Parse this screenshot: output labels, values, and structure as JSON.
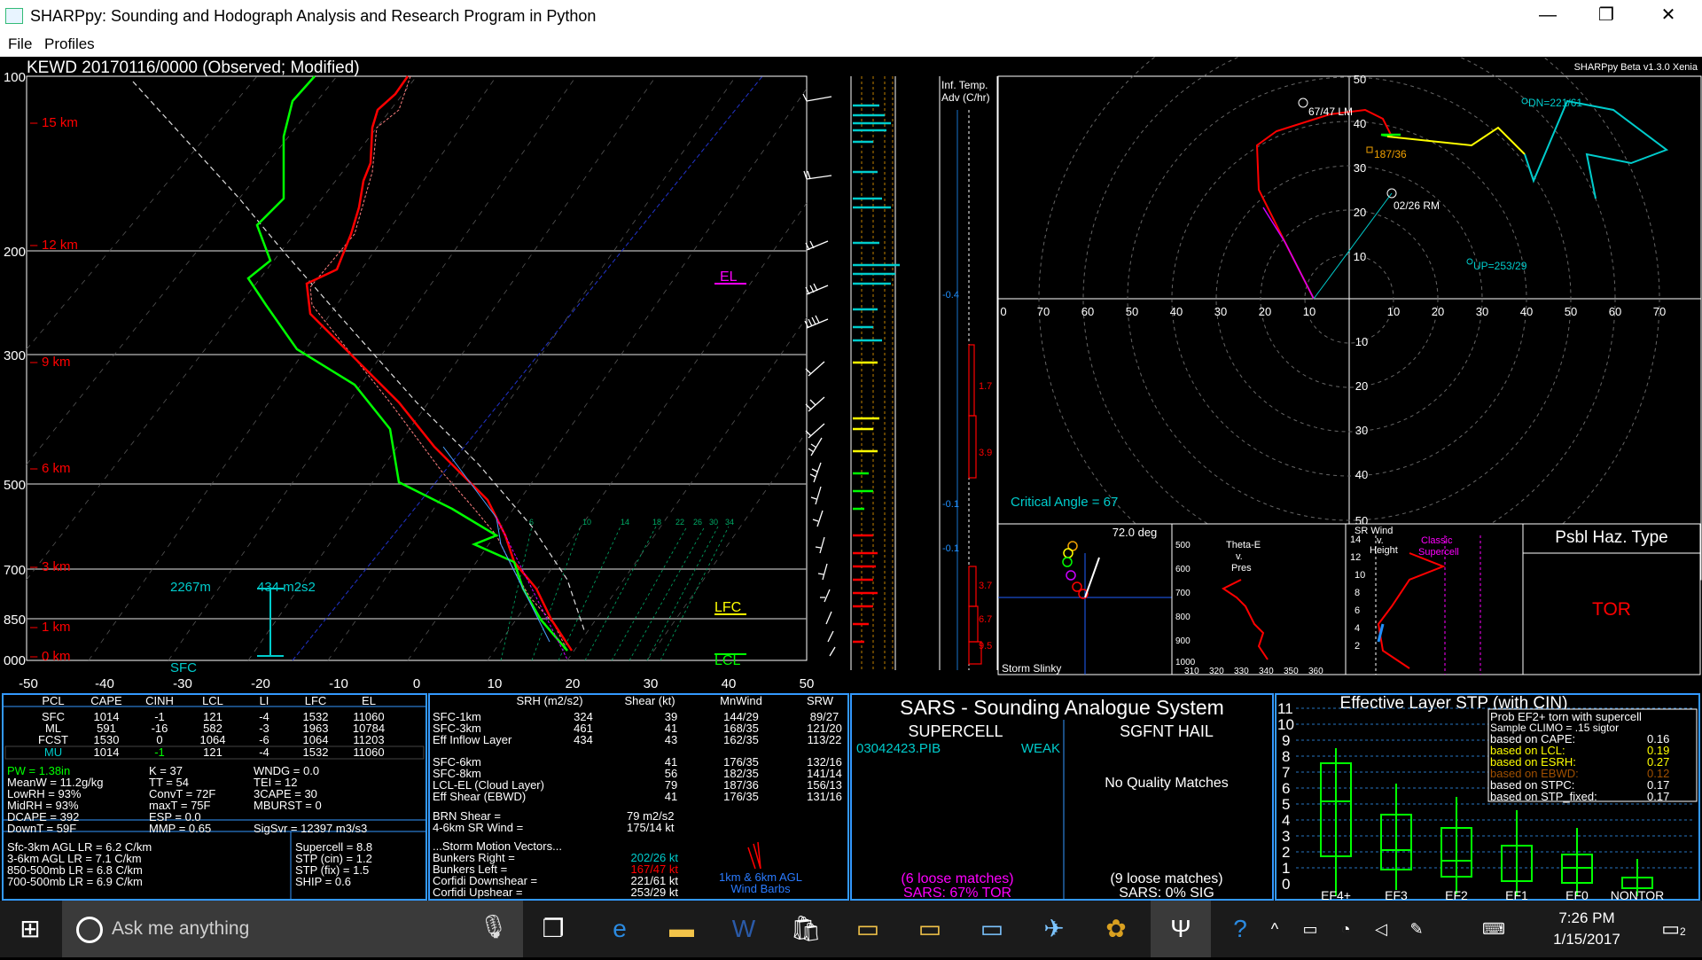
{
  "window": {
    "title": "SHARPpy: Sounding and Hodograph Analysis and Research Program in Python",
    "minimize": "—",
    "maximize": "❐",
    "close": "✕"
  },
  "menu": {
    "file": "File",
    "profiles": "Profiles"
  },
  "version": "SHARPpy Beta v1.3.0 Xenia",
  "skewt": {
    "header": "KEWD   20170116/0000  (Observed; Modified)",
    "pressure_labels": [
      "100",
      "200",
      "300",
      "500",
      "700",
      "850",
      "000"
    ],
    "height_labels": [
      "15 km",
      "12 km",
      "9 km",
      "6 km",
      "3 km",
      "1 km",
      "0 km"
    ],
    "temp_ticks": [
      "-50",
      "-40",
      "-30",
      "-20",
      "-10",
      "0",
      "10",
      "20",
      "30",
      "40",
      "50"
    ],
    "el": "EL",
    "lfc": "LFC",
    "lcl": "LCL",
    "eff_inflow_depth": "2267m",
    "eff_inflow_srh": "434 m2s2",
    "sfc": "SFC",
    "mix_ticks": [
      "6",
      "10",
      "14",
      "18",
      "22",
      "26",
      "30",
      "34"
    ]
  },
  "inf_temp": {
    "title": "Inf. Temp.",
    "subtitle": "Adv (C/hr)",
    "values": [
      "-0.4",
      "1.7",
      "3.9",
      "-0.1",
      "-0.1",
      "3.7",
      "6.7",
      "9.5"
    ]
  },
  "hodo": {
    "labels_top": [
      "50",
      "40",
      "30",
      "20",
      "10"
    ],
    "labels_bottom": [
      "10",
      "20",
      "30",
      "40",
      "50"
    ],
    "labels_x": [
      "0",
      "70",
      "60",
      "50",
      "40",
      "30",
      "20",
      "10",
      "10",
      "20",
      "30",
      "40",
      "50",
      "60",
      "70"
    ],
    "lm": "67/47 LM",
    "rm": "02/26 RM",
    "mean": "187/36",
    "corfidi_dn": "DN=221/61",
    "corfidi_up": "UP=253/29",
    "critical_angle": "Critical Angle = 67"
  },
  "slinky": {
    "angle": "72.0 deg",
    "title": "Storm Slinky"
  },
  "theta": {
    "title1": "Theta-E",
    "title2": "v.",
    "title3": "Pres",
    "yticks": [
      "500",
      "600",
      "700",
      "800",
      "900",
      "1000"
    ],
    "xticks": [
      "310",
      "320",
      "330",
      "340",
      "350",
      "360"
    ]
  },
  "srwind": {
    "title1": "SR Wind",
    "title2": "v.",
    "title3": "Height",
    "classic": "Classic",
    "supercell": "Supercell",
    "yticks": [
      "14",
      "12",
      "10",
      "8",
      "6",
      "4",
      "2"
    ]
  },
  "haz": {
    "title": "Psbl Haz. Type",
    "value": "TOR"
  },
  "parcels": {
    "headers": [
      "PCL",
      "CAPE",
      "CINH",
      "LCL",
      "LI",
      "LFC",
      "EL"
    ],
    "rows": [
      [
        "SFC",
        "1014",
        "-1",
        "121",
        "-4",
        "1532",
        "11060"
      ],
      [
        "ML",
        "591",
        "-16",
        "582",
        "-3",
        "1963",
        "10784"
      ],
      [
        "FCST",
        "1530",
        "0",
        "1064",
        "-6",
        "1064",
        "11203"
      ],
      [
        "MU",
        "1014",
        "-1",
        "121",
        "-4",
        "1532",
        "11060"
      ]
    ]
  },
  "indices": {
    "col1": [
      "PW = 1.38in",
      "MeanW = 11.2g/kg",
      "LowRH = 93%",
      "MidRH = 93%",
      "DCAPE = 392",
      "DownT = 59F"
    ],
    "col2": [
      "K = 37",
      "TT = 54",
      "ConvT = 72F",
      "maxT = 75F",
      "ESP = 0.0",
      "MMP = 0.65"
    ],
    "col3": [
      "WNDG = 0.0",
      "TEI = 12",
      "3CAPE = 30",
      "MBURST = 0",
      "",
      "SigSvr = 12397 m3/s3"
    ],
    "lapse": [
      "Sfc-3km AGL LR = 6.2 C/km",
      "3-6km AGL LR = 7.1 C/km",
      "850-500mb LR = 6.8 C/km",
      "700-500mb LR = 6.9 C/km"
    ],
    "composite": [
      "Supercell = 8.8",
      "STP (cin) = 1.2",
      "STP (fix) = 1.5",
      "SHIP = 0.6"
    ]
  },
  "kinematics": {
    "headers": [
      "SRH (m2/s2)",
      "Shear (kt)",
      "MnWind",
      "SRW"
    ],
    "rows": [
      [
        "SFC-1km",
        "324",
        "39",
        "144/29",
        "89/27"
      ],
      [
        "SFC-3km",
        "461",
        "41",
        "168/35",
        "121/20"
      ],
      [
        "Eff Inflow Layer",
        "434",
        "43",
        "162/35",
        "113/22"
      ],
      [
        "SFC-6km",
        "",
        "41",
        "176/35",
        "132/16"
      ],
      [
        "SFC-8km",
        "",
        "56",
        "182/35",
        "141/14"
      ],
      [
        "LCL-EL (Cloud Layer)",
        "",
        "79",
        "187/36",
        "156/13"
      ],
      [
        "Eff Shear (EBWD)",
        "",
        "41",
        "176/35",
        "131/16"
      ]
    ],
    "brn_label": "BRN Shear =",
    "brn_value": "79 m2/s2",
    "sr46_label": "4-6km SR Wind =",
    "sr46_value": "175/14 kt",
    "storm_motion": "...Storm Motion Vectors...",
    "motions": [
      [
        "Bunkers Right =",
        "202/26 kt"
      ],
      [
        "Bunkers Left =",
        "167/47 kt"
      ],
      [
        "Corfidi Downshear =",
        "221/61 kt"
      ],
      [
        "Corfidi Upshear =",
        "253/29 kt"
      ]
    ],
    "barbs_caption1": "1km & 6km AGL",
    "barbs_caption2": "Wind Barbs"
  },
  "sars": {
    "title": "SARS - Sounding Analogue System",
    "supercell": "SUPERCELL",
    "hail": "SGFNT HAIL",
    "match": "03042423.PIB",
    "match_type": "WEAK",
    "no_quality": "No Quality Matches",
    "loose_sc": "(6 loose matches)",
    "sars_sc": "SARS: 67% TOR",
    "loose_hail": "(9 loose matches)",
    "sars_hail": "SARS: 0% SIG"
  },
  "stp": {
    "title": "Effective Layer STP (with CIN)",
    "yticks": [
      "11",
      "10",
      "9",
      "8",
      "7",
      "6",
      "5",
      "4",
      "3",
      "2",
      "1",
      "0"
    ],
    "categories": [
      "EF4+",
      "EF3",
      "EF2",
      "EF1",
      "EF0",
      "NONTOR"
    ],
    "prob_title": "Prob EF2+ torn with supercell",
    "sample": "Sample CLIMO = .15 sigtor",
    "rows": [
      [
        "based on CAPE:",
        "0.16"
      ],
      [
        "based on LCL:",
        "0.19"
      ],
      [
        "based on ESRH:",
        "0.27"
      ],
      [
        "based on EBWD:",
        "0.12"
      ],
      [
        "based on STPC:",
        "0.17"
      ],
      [
        "based on STP_fixed:",
        "0.17"
      ]
    ]
  },
  "taskbar": {
    "search_placeholder": "Ask me anything",
    "time": "7:26 PM",
    "date": "1/15/2017",
    "notif": "2"
  }
}
